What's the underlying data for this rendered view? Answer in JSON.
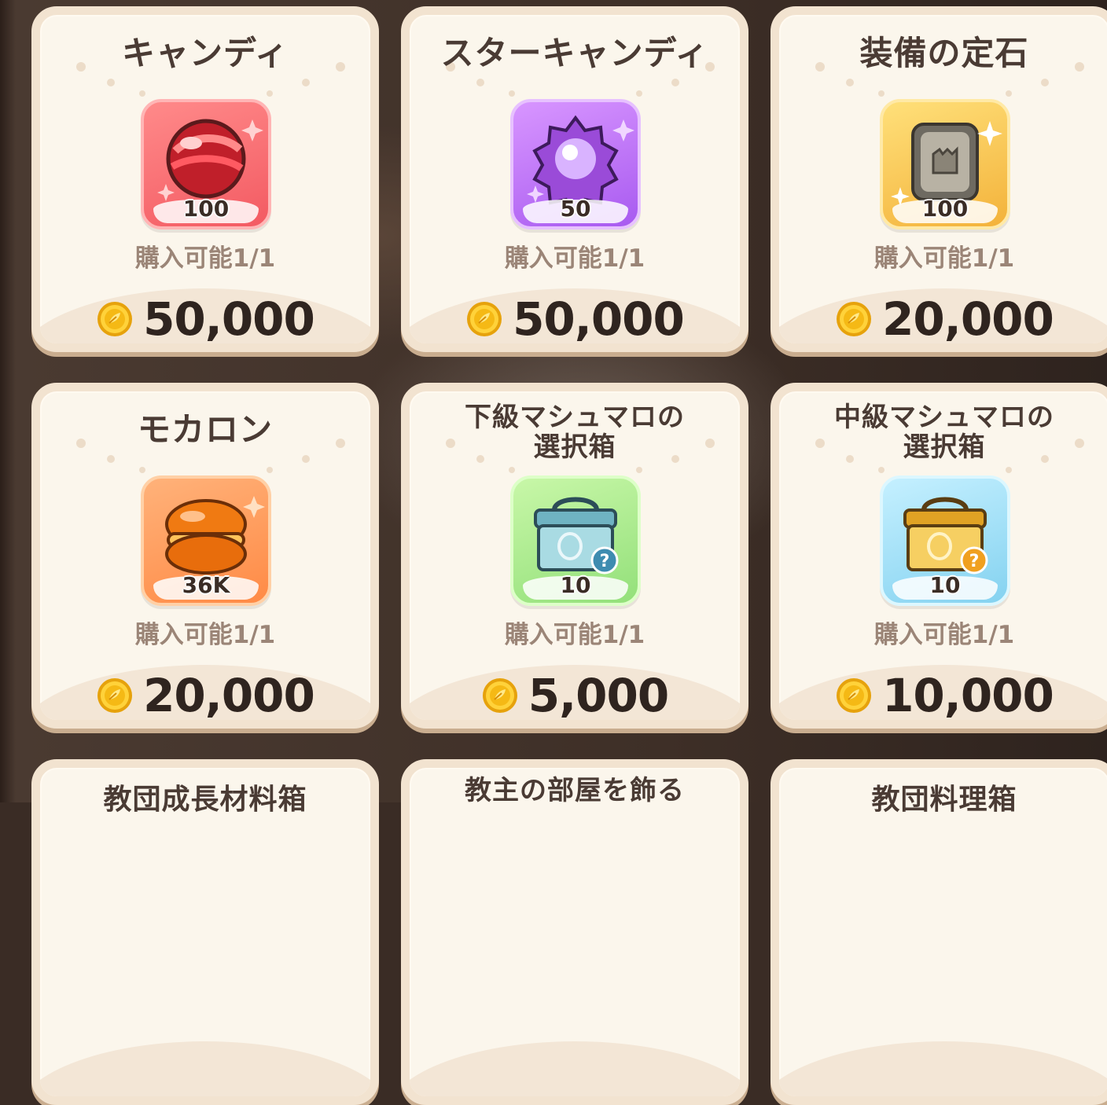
{
  "shop": {
    "currency_icon": "gold-coin-icon",
    "items": [
      {
        "title": "キャンディ",
        "icon": "red-candy-icon",
        "quantity": "100",
        "limit": "購入可能1/1",
        "price": "50,000"
      },
      {
        "title": "スターキャンディ",
        "icon": "star-candy-icon",
        "quantity": "50",
        "limit": "購入可能1/1",
        "price": "50,000"
      },
      {
        "title": "装備の定石",
        "icon": "equipment-stone-icon",
        "quantity": "100",
        "limit": "購入可能1/1",
        "price": "20,000"
      },
      {
        "title": "モカロン",
        "icon": "macaron-icon",
        "quantity": "36K",
        "limit": "購入可能1/1",
        "price": "20,000"
      },
      {
        "title": "下級マシュマロの\n選択箱",
        "title_line1": "下級マシュマロの",
        "title_line2": "選択箱",
        "icon": "blue-chest-icon",
        "quantity": "10",
        "limit": "購入可能1/1",
        "price": "5,000"
      },
      {
        "title": "中級マシュマロの\n選択箱",
        "title_line1": "中級マシュマロの",
        "title_line2": "選択箱",
        "icon": "gold-chest-icon",
        "quantity": "10",
        "limit": "購入可能1/1",
        "price": "10,000"
      },
      {
        "title": "教団成長材料箱"
      },
      {
        "title": "教主の部屋を飾る"
      },
      {
        "title": "教団料理箱"
      }
    ]
  }
}
